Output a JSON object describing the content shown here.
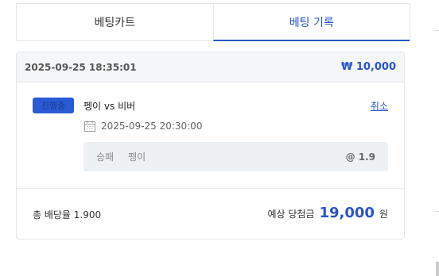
{
  "tabs": [
    {
      "label": "베팅카트",
      "active": false
    },
    {
      "label": "베팅 기록",
      "active": true
    }
  ],
  "bet": {
    "placed_at": "2025-09-25 18:35:01",
    "amount": "₩ 10,000",
    "status": "진행중",
    "match": "펭이 vs 비버",
    "cancel_label": "취소",
    "match_time": "2025-09-25 20:30:00",
    "selection": {
      "type": "승패",
      "pick": "펭이",
      "odds": "@ 1.9"
    },
    "total_odds_label": "총 배당율 1.900",
    "expected_label": "예상 당첨금",
    "expected_value": "19,000",
    "expected_unit": "원"
  },
  "colors": {
    "accent": "#2a55c8",
    "badge": "#2a5bd7"
  }
}
